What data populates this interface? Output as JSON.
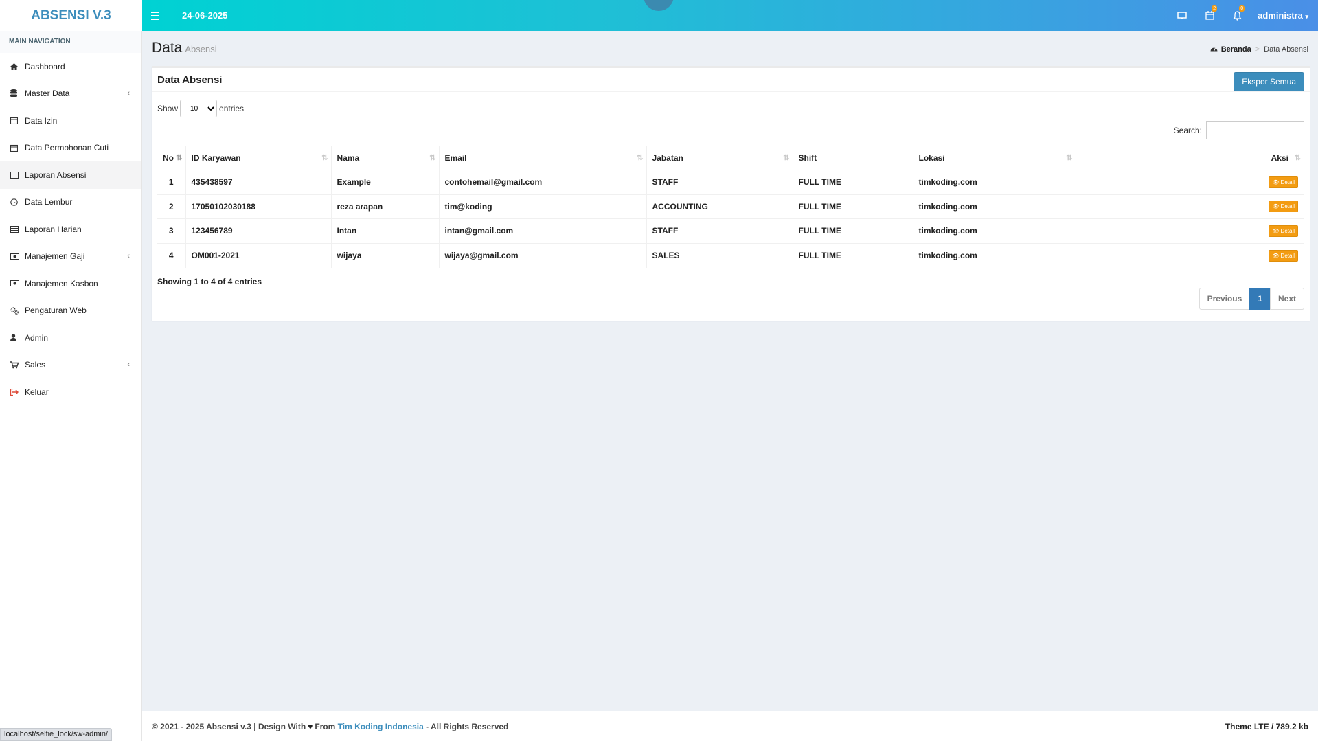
{
  "app": {
    "title": "ABSENSI V.3"
  },
  "navbar": {
    "date": "24-06-2025",
    "icons": [
      "desktop-icon",
      "calendar-icon",
      "bell-icon"
    ],
    "calendar_badge": "2",
    "bell_badge": "0",
    "user": "administra"
  },
  "sidebar": {
    "header": "MAIN NAVIGATION",
    "items": [
      {
        "label": "Dashboard",
        "icon": "home-icon"
      },
      {
        "label": "Master Data",
        "icon": "database-icon"
      },
      {
        "label": "Data Izin",
        "icon": "calendar-icon"
      },
      {
        "label": "Data Permohonan Cuti",
        "icon": "calendar-icon"
      },
      {
        "label": "Laporan Absensi",
        "icon": "list-icon"
      },
      {
        "label": "Data Lembur",
        "icon": "clock-icon"
      },
      {
        "label": "Laporan Harian",
        "icon": "list-icon"
      },
      {
        "label": "Manajemen Gaji",
        "icon": "money-icon"
      },
      {
        "label": "Manajemen Kasbon",
        "icon": "money-icon"
      },
      {
        "label": "Pengaturan Web",
        "icon": "cogs-icon"
      },
      {
        "label": "Admin",
        "icon": "user-icon"
      },
      {
        "label": "Sales",
        "icon": "cart-icon"
      },
      {
        "label": "Keluar",
        "icon": "sign-out-icon"
      }
    ]
  },
  "page": {
    "title": "Data",
    "subtitle": "Absensi"
  },
  "breadcrumb": {
    "home": "Beranda",
    "current": "Data Absensi"
  },
  "box": {
    "title": "Data Absensi",
    "export_label": "Ekspor Semua"
  },
  "table_controls": {
    "show_label": "Show",
    "page_size": "10",
    "entries_label": "entries",
    "search_label": "Search:",
    "search_value": ""
  },
  "table": {
    "headers": [
      "No",
      "ID Karyawan",
      "Nama",
      "Email",
      "Jabatan",
      "Shift",
      "Lokasi",
      "Aksi"
    ],
    "rows": [
      {
        "no": "1",
        "id": "435438597",
        "nama": "Example",
        "email": "contohemail@gmail.com",
        "jabatan": "STAFF",
        "shift": "FULL TIME",
        "lokasi": "timkoding.com",
        "aksi": "Detail"
      },
      {
        "no": "2",
        "id": "17050102030188",
        "nama": "reza arapan",
        "email": "tim@koding",
        "jabatan": "ACCOUNTING",
        "shift": "FULL TIME",
        "lokasi": "timkoding.com",
        "aksi": "Detail"
      },
      {
        "no": "3",
        "id": "123456789",
        "nama": "Intan",
        "email": "intan@gmail.com",
        "jabatan": "STAFF",
        "shift": "FULL TIME",
        "lokasi": "timkoding.com",
        "aksi": "Detail"
      },
      {
        "no": "4",
        "id": "OM001-2021",
        "nama": "wijaya",
        "email": "wijaya@gmail.com",
        "jabatan": "SALES",
        "shift": "FULL TIME",
        "lokasi": "timkoding.com",
        "aksi": "Detail"
      }
    ]
  },
  "pagination": {
    "info": "Showing 1 to 4 of 4 entries",
    "previous": "Previous",
    "current": "1",
    "next": "Next"
  },
  "footer": {
    "left_prefix": "© 2021 - 2025 Absensi v.3 | Design With",
    "left_from": "From",
    "link": "Tim Koding Indonesia",
    "left_suffix": "- All Rights Reserved",
    "right": "Theme LTE / 789.2 kb"
  },
  "statusbar": {
    "url": "localhost/selfie_lock/sw-admin/"
  },
  "colors": {
    "brand": "#3c8dbc",
    "warning": "#f39c12",
    "navbar_start": "#00d2d3",
    "navbar_end": "#4a8fe7"
  }
}
